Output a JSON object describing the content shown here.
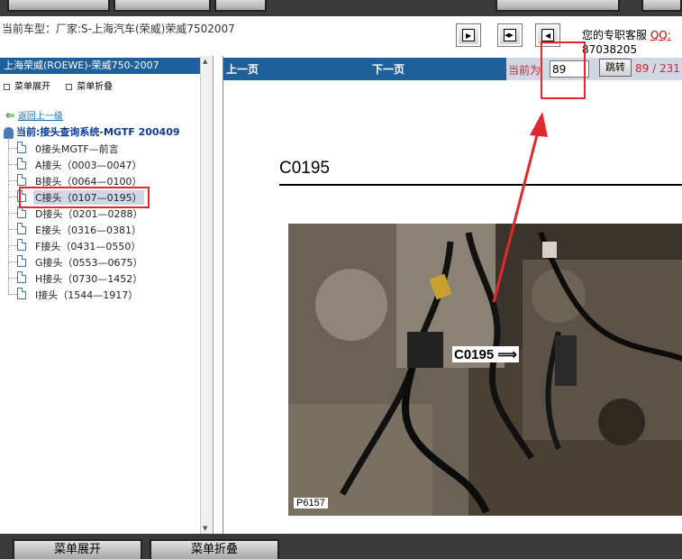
{
  "vehicle": {
    "label": "当前车型：厂家:S-上海汽车(荣威)荣威7502007"
  },
  "service": {
    "label": "您的专职客服",
    "qq_label": "QQ:",
    "phone": "87038205"
  },
  "left": {
    "title": "上海荣威(ROEWE)-荣威750-2007",
    "expand_label": "菜单展开",
    "collapse_label": "菜单折叠",
    "back_label": "返回上一级",
    "current_label": "当前:接头查询系统-MGTF 200409",
    "items": [
      {
        "label": "0接头MGTF—前言"
      },
      {
        "label": "A接头（0003—0047）"
      },
      {
        "label": "B接头（0064—0100）"
      },
      {
        "label": "C接头（0107—0195）"
      },
      {
        "label": "D接头（0201—0288）"
      },
      {
        "label": "E接头（0316—0381）"
      },
      {
        "label": "F接头（0431—0550）"
      },
      {
        "label": "G接头（0553—0675）"
      },
      {
        "label": "H接头（0730—1452）"
      },
      {
        "label": "I接头（1544—1917）"
      }
    ]
  },
  "nav": {
    "prev_label": "上一页",
    "next_label": "下一页",
    "current_page_label": "当前为",
    "page_value": "89",
    "jump_label": "跳转",
    "page_total": "89 / 231"
  },
  "document": {
    "title": "C0195",
    "photo_callout": "C0195",
    "photo_ref": "P6157"
  },
  "bottom": {
    "expand_button": "菜单展开",
    "collapse_button": "菜单折叠"
  },
  "colors": {
    "nav_blue": "#1f5f9a",
    "annotation_red": "#e0282e",
    "page_red": "#d4242a"
  }
}
